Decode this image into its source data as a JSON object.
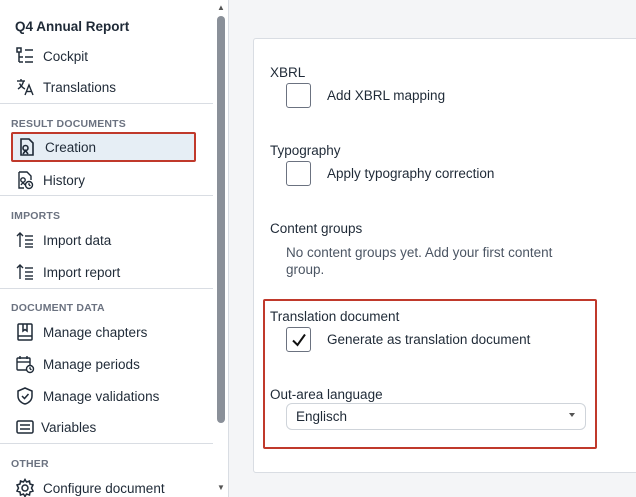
{
  "sidebar": {
    "title": "Q4 Annual Report",
    "top_items": [
      {
        "label": "Cockpit",
        "icon": "cockpit-icon"
      },
      {
        "label": "Translations",
        "icon": "translate-icon"
      }
    ],
    "result_documents": {
      "heading": "RESULT DOCUMENTS",
      "items": [
        {
          "label": "Creation",
          "icon": "document-creation-icon",
          "active": true
        },
        {
          "label": "History",
          "icon": "history-icon"
        }
      ]
    },
    "imports": {
      "heading": "IMPORTS",
      "items": [
        {
          "label": "Import data",
          "icon": "import-data-icon"
        },
        {
          "label": "Import report",
          "icon": "import-report-icon"
        }
      ]
    },
    "document_data": {
      "heading": "DOCUMENT DATA",
      "items": [
        {
          "label": "Manage chapters",
          "icon": "book-icon"
        },
        {
          "label": "Manage periods",
          "icon": "calendar-clock-icon"
        },
        {
          "label": "Manage validations",
          "icon": "shield-check-icon"
        },
        {
          "label": "Variables",
          "icon": "variables-icon"
        }
      ]
    },
    "other": {
      "heading": "OTHER",
      "items": [
        {
          "label": "Configure document",
          "icon": "gear-icon"
        }
      ]
    }
  },
  "main": {
    "xbrl": {
      "heading": "XBRL",
      "checkbox_label": "Add XBRL mapping",
      "checked": false
    },
    "typography": {
      "heading": "Typography",
      "checkbox_label": "Apply typography correction",
      "checked": false
    },
    "content_groups": {
      "heading": "Content groups",
      "empty_text": "No content groups yet. Add your first content group."
    },
    "translation_document": {
      "heading": "Translation document",
      "checkbox_label": "Generate as translation document",
      "checked": true
    },
    "out_area_language": {
      "heading": "Out-area language",
      "selected": "Englisch"
    }
  },
  "colors": {
    "highlight_border": "#c0392b",
    "active_item_bg": "#e6eef5",
    "text": "#1f2a37",
    "section_heading": "#6b7280"
  }
}
